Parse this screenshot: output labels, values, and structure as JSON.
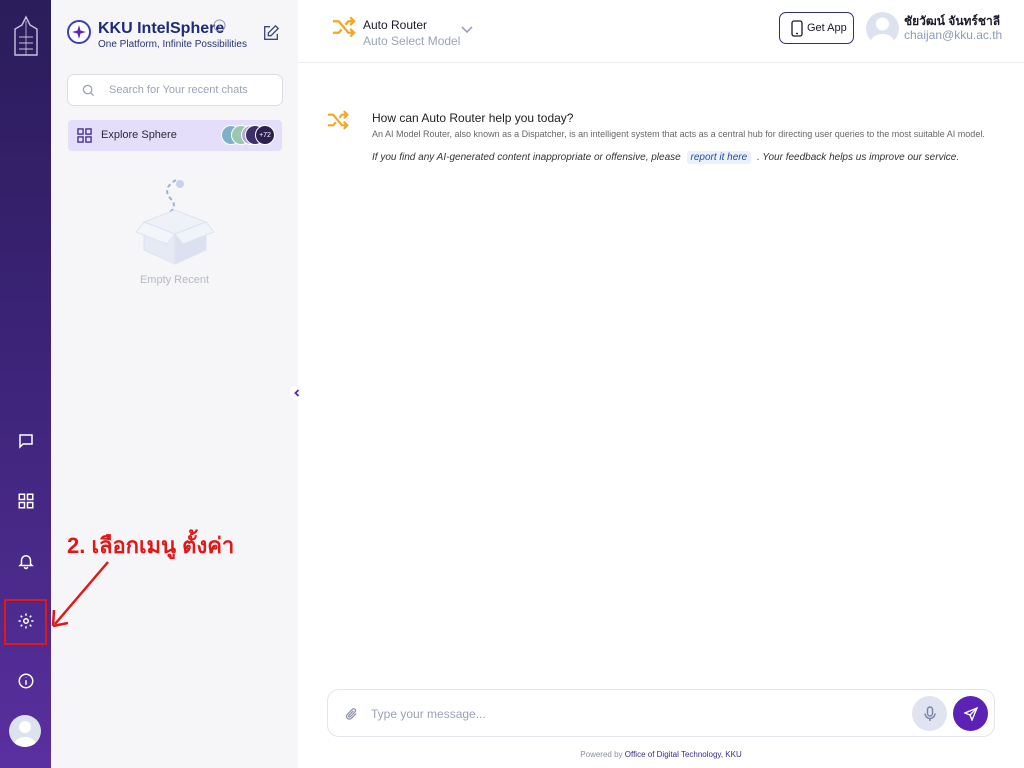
{
  "brand": {
    "title": "KKU IntelSphere",
    "subtitle": "One Platform, Infinite Possibilities"
  },
  "search": {
    "placeholder": "Search for Your recent chats"
  },
  "explore": {
    "label": "Explore Sphere",
    "more_count": "+72"
  },
  "recent": {
    "empty_label": "Empty Recent"
  },
  "model": {
    "name": "Auto Router",
    "subtitle": "Auto Select Model"
  },
  "header": {
    "get_app": "Get App"
  },
  "user": {
    "name": "ชัยวัฒน์ จันทร์ชาลี",
    "email": "chaijan@kku.ac.th"
  },
  "welcome": {
    "title": "How can Auto Router help you today?",
    "description": "An AI Model Router, also known as a Dispatcher, is an intelligent system that acts as a central hub for directing user queries to the most suitable AI model.",
    "note_before": "If you find any AI-generated content inappropriate or offensive, please",
    "report_link": "report it here",
    "note_after": ". Your feedback helps us improve our service."
  },
  "composer": {
    "placeholder": "Type your message..."
  },
  "footer": {
    "prefix": "Powered by",
    "org": "Office of Digital Technology, KKU"
  },
  "annotation": {
    "text": "2. เลือกเมนู ตั้งค่า"
  },
  "colors": {
    "accent": "#5b22b5",
    "router_orange": "#f5a623",
    "annotation_red": "#e01818",
    "rail_top": "#2a1d5a"
  },
  "rail_icons": [
    "logo-icon",
    "chat-icon",
    "grid-icon",
    "bell-icon",
    "settings-icon",
    "info-icon",
    "avatar"
  ]
}
